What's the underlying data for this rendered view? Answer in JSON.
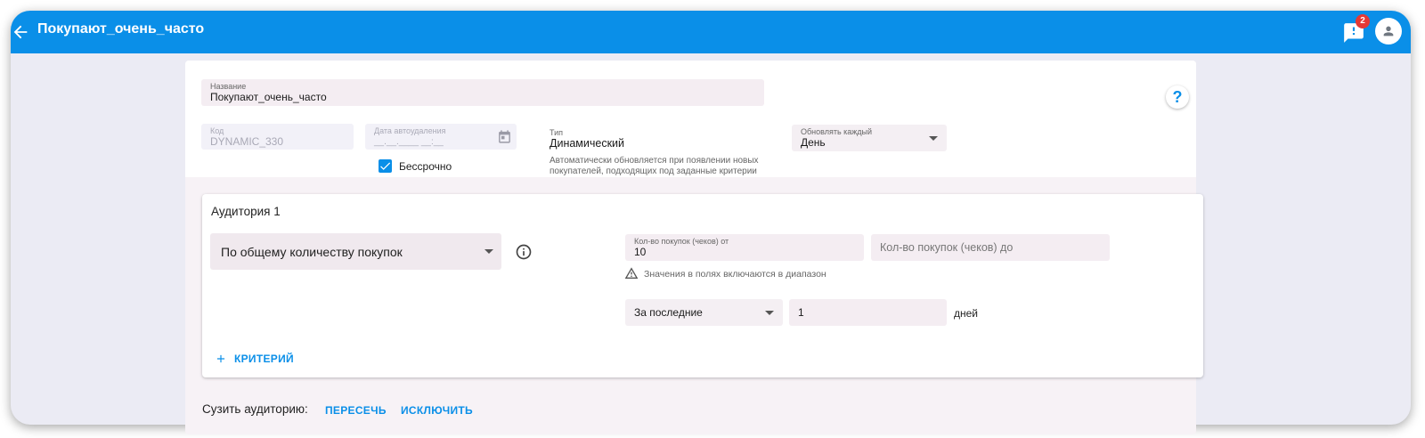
{
  "header": {
    "title": "Покупают_очень_часто",
    "notifications_count": "2"
  },
  "form": {
    "name": {
      "label": "Название",
      "value": "Покупают_очень_часто"
    },
    "code": {
      "label": "Код",
      "value": "DYNAMIC_330"
    },
    "autodelete": {
      "label": "Дата автоудаления",
      "placeholder": "__.__.____ __:__"
    },
    "forever": {
      "label": "Бессрочно",
      "checked": true
    },
    "type": {
      "label": "Тип",
      "value": "Динамический",
      "hint": "Автоматически обновляется при появлении новых покупателей, подходящих под заданные критерии"
    },
    "refresh": {
      "label": "Обновлять каждый",
      "value": "День"
    },
    "help": "?"
  },
  "audience": {
    "title": "Аудитория 1",
    "criterion_select": "По общему количеству покупок",
    "count_from": {
      "label": "Кол-во покупок (чеков) от",
      "value": "10"
    },
    "count_to": {
      "placeholder": "Кол-во покупок (чеков) до"
    },
    "warning": "Значения в полях включаются в диапазон",
    "period_select": "За последние",
    "period_value": "1",
    "period_unit": "дней",
    "add_criterion": "КРИТЕРИЙ"
  },
  "narrow": {
    "label": "Сузить аудиторию:",
    "intersect": "ПЕРЕСЕЧЬ",
    "exclude": "ИСКЛЮЧИТЬ"
  },
  "colors": {
    "primary": "#0a8fe8",
    "badge": "#e53935"
  }
}
